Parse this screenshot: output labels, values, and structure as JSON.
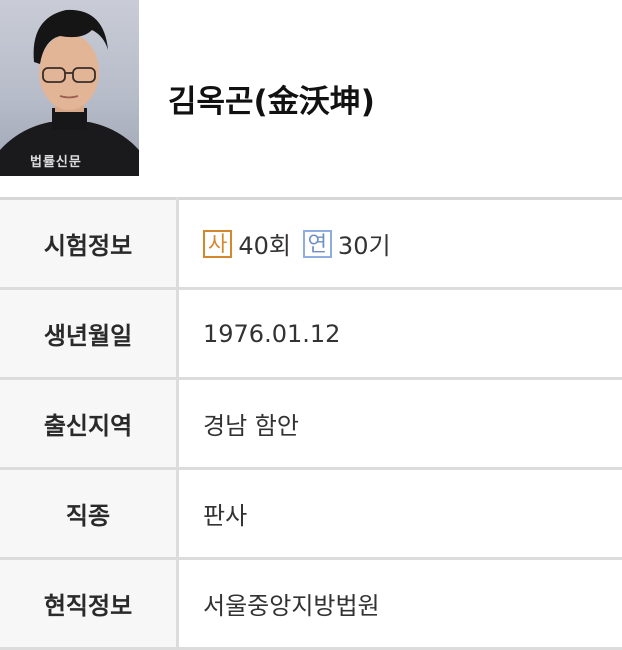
{
  "profile": {
    "name": "김옥곤(金沃坤)",
    "photo_watermark": "법률신문"
  },
  "rows": [
    {
      "label": "시험정보"
    },
    {
      "label": "생년월일",
      "value": "1976.01.12"
    },
    {
      "label": "출신지역",
      "value": "경남 함안"
    },
    {
      "label": "직종",
      "value": "판사"
    },
    {
      "label": "현직정보",
      "value": "서울중앙지방법원"
    }
  ],
  "exam": {
    "sa_badge": "사",
    "sa_value": "40회",
    "yeon_badge": "연",
    "yeon_value": "30기"
  },
  "colors": {
    "sa": "#d4882e",
    "yeon": "#6c8fc8",
    "label_bg": "#f7f7f7",
    "border": "#dcdcdc"
  }
}
